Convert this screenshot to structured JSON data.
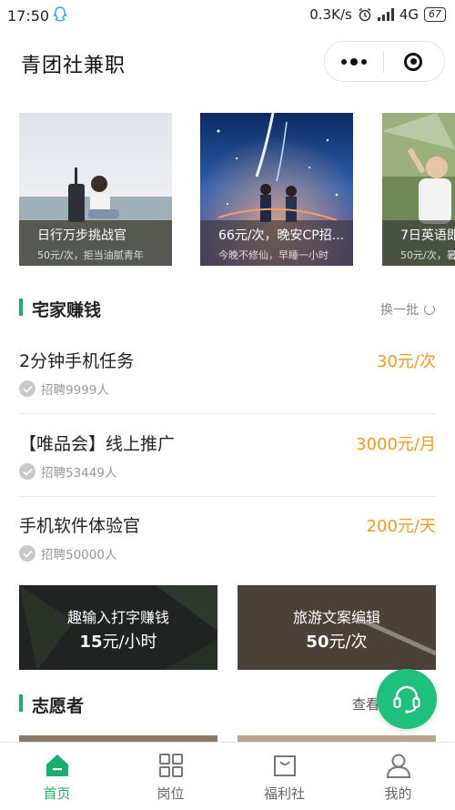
{
  "status": {
    "time": "17:50",
    "speed": "0.3K/s",
    "network": "4G",
    "battery": "67"
  },
  "app": {
    "title": "青团社兼职"
  },
  "banners": [
    {
      "title": "日行万步挑战官",
      "subtitle": "50元/次，拒当油腻青年"
    },
    {
      "title": "66元/次，晚安CP招...",
      "subtitle": "今晚不修仙，早睡一小时"
    },
    {
      "title": "7日英语即",
      "subtitle": "50元/次，暑"
    }
  ],
  "home_jobs": {
    "title": "宅家赚钱",
    "refresh_label": "换一批",
    "items": [
      {
        "name": "2分钟手机任务",
        "pay": "30元/次",
        "hire": "招聘9999人"
      },
      {
        "name": "【唯品会】线上推广",
        "pay": "3000元/月",
        "hire": "招聘53449人"
      },
      {
        "name": "手机软件体验官",
        "pay": "200元/天",
        "hire": "招聘50000人"
      }
    ]
  },
  "promos": [
    {
      "title": "趣输入打字赚钱",
      "amount": "15",
      "unit": "元/小时"
    },
    {
      "title": "旅游文案编辑",
      "amount": "50",
      "unit": "元/次"
    }
  ],
  "volunteer": {
    "title": "志愿者",
    "more_label": "查看"
  },
  "tabs": [
    {
      "label": "首页",
      "icon": "home-icon",
      "active": true
    },
    {
      "label": "岗位",
      "icon": "grid-icon",
      "active": false
    },
    {
      "label": "福利社",
      "icon": "bag-icon",
      "active": false
    },
    {
      "label": "我的",
      "icon": "user-icon",
      "active": false
    }
  ],
  "colors": {
    "accent": "#1ab06a",
    "pay": "#f39a1e",
    "fab": "#1fc07b"
  }
}
